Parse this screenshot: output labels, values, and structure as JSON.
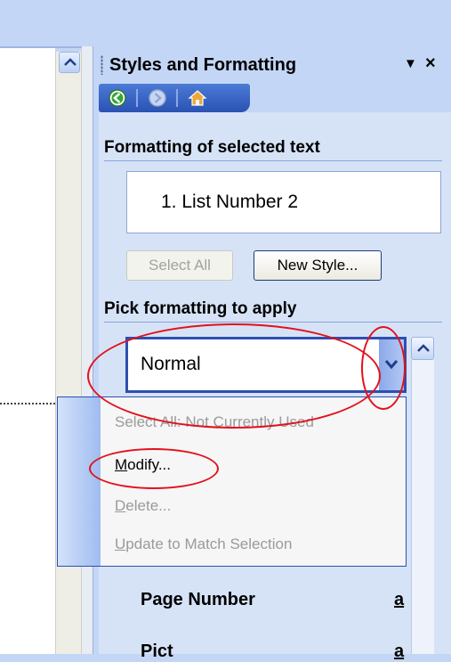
{
  "pane": {
    "title": "Styles and Formatting",
    "menu_glyph": "▼",
    "close_glyph": "×"
  },
  "nav": {
    "back_icon": "back-arrow-icon",
    "forward_icon": "forward-arrow-icon",
    "home_icon": "home-icon"
  },
  "formatting": {
    "section_title": "Formatting of selected text",
    "current_text": "1.  List Number 2"
  },
  "buttons": {
    "select_all": "Select All",
    "new_style": "New Style..."
  },
  "pick": {
    "section_title": "Pick formatting to apply",
    "selected_style": "Normal"
  },
  "context_menu": {
    "items": [
      {
        "label": "Select All: Not Currently Used",
        "accel": "",
        "rest": "",
        "enabled": false
      },
      {
        "label": "Modify...",
        "accel": "M",
        "rest": "odify...",
        "enabled": true
      },
      {
        "label": "Delete...",
        "accel": "D",
        "rest": "elete...",
        "enabled": false
      },
      {
        "label": "Update to Match Selection",
        "accel": "U",
        "rest": "pdate to Match Selection",
        "enabled": false
      }
    ]
  },
  "style_list": {
    "rows": [
      {
        "name": "Page Number",
        "marker": "a"
      },
      {
        "name": "Pict",
        "marker": "a"
      }
    ]
  },
  "colors": {
    "annotation": "#e3111b",
    "accent": "#2e4fb0"
  }
}
